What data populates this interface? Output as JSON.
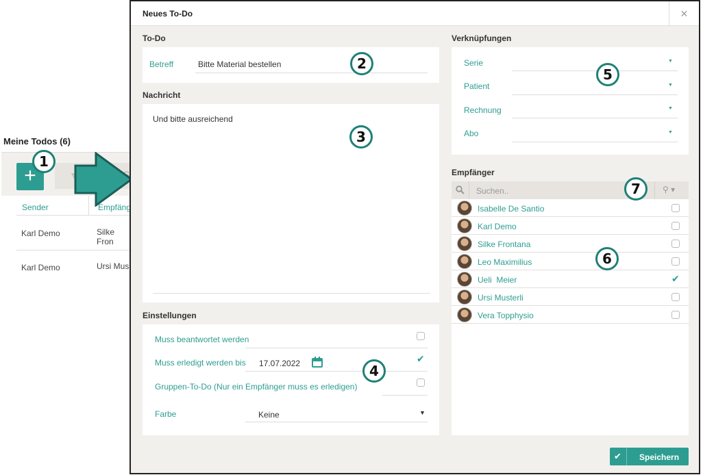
{
  "background": {
    "title": "Meine Todos (6)",
    "add_label": "+",
    "search_partial": "S",
    "columns": [
      "Sender",
      "Empfäng"
    ],
    "rows": [
      {
        "sender": "Karl Demo",
        "recipient": "Silke Fron"
      },
      {
        "sender": "Karl Demo",
        "recipient": "Ursi Mus"
      }
    ]
  },
  "callouts": [
    "1",
    "2",
    "3",
    "4",
    "5",
    "6",
    "7"
  ],
  "dialog": {
    "title": "Neues To-Do",
    "close_icon": "×",
    "todo": {
      "label": "To-Do",
      "subject_label": "Betreff",
      "subject_value": "Bitte Material bestellen"
    },
    "message": {
      "label": "Nachricht",
      "value": "Und bitte ausreichend"
    },
    "settings": {
      "label": "Einstellungen",
      "must_answer": "Muss beantwortet werden",
      "must_done_by": "Muss erledigt werden bis",
      "due_date": "17.07.2022",
      "group_todo": "Gruppen-To-Do (Nur ein Empfänger muss es erledigen)",
      "color_label": "Farbe",
      "color_value": "Keine",
      "must_answer_checked": false,
      "must_done_checked": true,
      "group_checked": false
    },
    "links": {
      "label": "Verknüpfungen",
      "items": [
        "Serie",
        "Patient",
        "Rechnung",
        "Abo"
      ]
    },
    "recipients": {
      "label": "Empfänger",
      "search_placeholder": "Suchen..",
      "list": [
        {
          "name": "Isabelle De Santio",
          "checked": false
        },
        {
          "name": "Karl Demo",
          "checked": false
        },
        {
          "name": "Silke Frontana",
          "checked": false
        },
        {
          "name": "Leo Maximilius",
          "checked": false
        },
        {
          "name": "Ueli  Meier",
          "checked": true
        },
        {
          "name": "Ursi Musterli",
          "checked": false
        },
        {
          "name": "Vera Topphysio",
          "checked": false
        }
      ]
    },
    "save_label": "Speichern",
    "accent": "#2e9d91"
  }
}
